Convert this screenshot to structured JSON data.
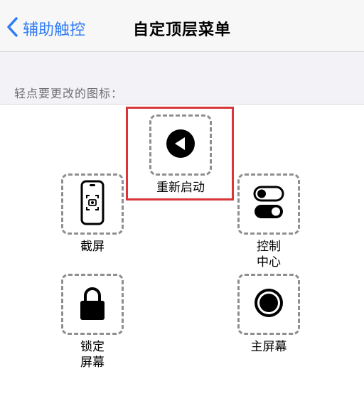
{
  "nav": {
    "back_label": "辅助触控",
    "title": "自定顶层菜单"
  },
  "section": {
    "label": "轻点要更改的图标："
  },
  "items": [
    {
      "label": "重新启动",
      "icon": "play-back-icon"
    },
    {
      "label": "截屏",
      "icon": "screenshot-icon"
    },
    {
      "label": "控制\n中心",
      "icon": "control-center-icon"
    },
    {
      "label": "锁定\n屏幕",
      "icon": "lock-icon"
    },
    {
      "label": "主屏幕",
      "icon": "home-icon"
    }
  ],
  "colors": {
    "accent": "#2f7cf6",
    "highlight": "#d9363a",
    "dashed_border": "#8e8e93"
  }
}
